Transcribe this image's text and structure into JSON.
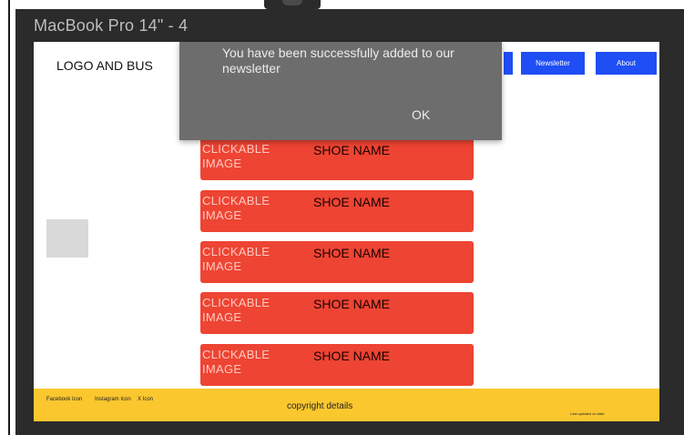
{
  "window": {
    "title": "MacBook Pro 14\" - 4"
  },
  "header": {
    "logo_text": "LOGO AND BUS",
    "nav": [
      {
        "label": ""
      },
      {
        "label": "Newsletter"
      },
      {
        "label": "About"
      }
    ]
  },
  "products": [
    {
      "image_label": "CLICKABLE IMAGE",
      "name": "SHOE NAME"
    },
    {
      "image_label": "CLICKABLE IMAGE",
      "name": "SHOE NAME"
    },
    {
      "image_label": "CLICKABLE IMAGE",
      "name": "SHOE NAME"
    },
    {
      "image_label": "CLICKABLE IMAGE",
      "name": "SHOE NAME"
    },
    {
      "image_label": "CLICKABLE IMAGE",
      "name": "SHOE NAME"
    }
  ],
  "footer": {
    "facebook": "Facebook Icon",
    "instagram": "Instagram Icon",
    "x": "X Icon",
    "copyright": "copyright details",
    "extra": "Last updated on date"
  },
  "toast": {
    "message": "You have been successfully added to our newsletter",
    "ok_label": "OK"
  },
  "colors": {
    "frame": "#2b2b2b",
    "nav_button": "#1f4ef5",
    "product_card": "#ee4433",
    "footer": "#fbc72f",
    "toast": "#6d6d6d"
  }
}
